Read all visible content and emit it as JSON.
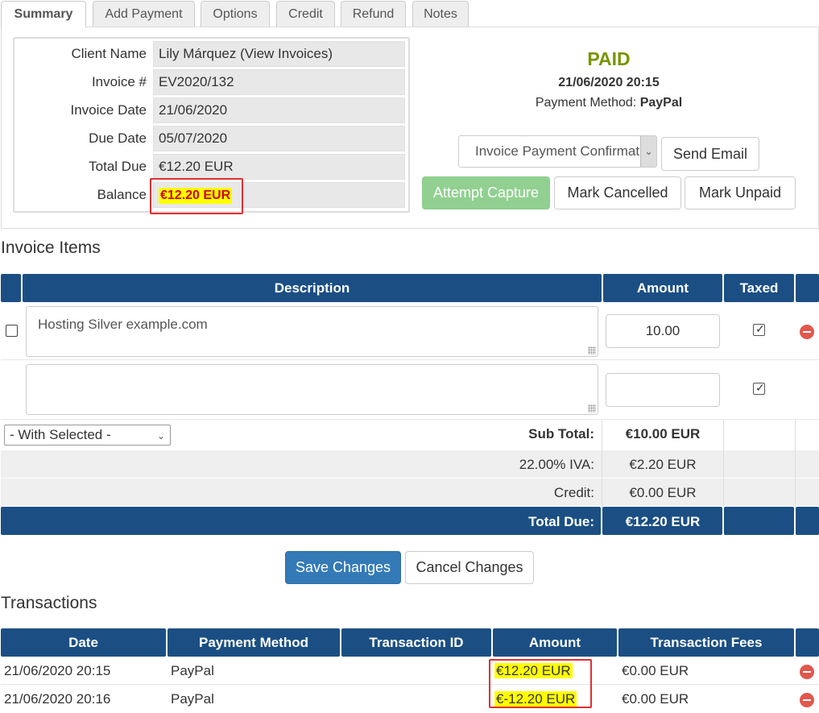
{
  "tabs": [
    "Summary",
    "Add Payment",
    "Options",
    "Credit",
    "Refund",
    "Notes"
  ],
  "summary": {
    "client_name_label": "Client Name",
    "client_name_value": "Lily Márquez (View Invoices)",
    "invoice_num_label": "Invoice #",
    "invoice_num_value": "EV2020/132",
    "invoice_date_label": "Invoice Date",
    "invoice_date_value": "21/06/2020",
    "due_date_label": "Due Date",
    "due_date_value": "05/07/2020",
    "total_due_label": "Total Due",
    "total_due_value": "€12.20 EUR",
    "balance_label": "Balance",
    "balance_value": "€12.20 EUR"
  },
  "status": {
    "state": "PAID",
    "datetime": "21/06/2020 20:15",
    "method_label": "Payment Method:",
    "method_value": "PayPal",
    "email_template": "Invoice Payment Confirmation",
    "send_email": "Send Email",
    "attempt_capture": "Attempt Capture",
    "mark_cancelled": "Mark Cancelled",
    "mark_unpaid": "Mark Unpaid",
    "colors": {
      "paid": "#779500",
      "header": "#1b4f84",
      "capture": "#91d091"
    }
  },
  "items": {
    "title": "Invoice Items",
    "headers": {
      "description": "Description",
      "amount": "Amount",
      "taxed": "Taxed"
    },
    "rows": [
      {
        "description": "Hosting Silver example.com",
        "amount": "10.00",
        "taxed": true
      },
      {
        "description": "",
        "amount": "",
        "taxed": true
      }
    ],
    "with_selected": "- With Selected -",
    "subtotal_label": "Sub Total:",
    "subtotal_value": "€10.00 EUR",
    "tax_label": "22.00% IVA:",
    "tax_value": "€2.20 EUR",
    "credit_label": "Credit:",
    "credit_value": "€0.00 EUR",
    "total_label": "Total Due:",
    "total_value": "€12.20 EUR"
  },
  "actions": {
    "save": "Save Changes",
    "cancel": "Cancel Changes"
  },
  "transactions": {
    "title": "Transactions",
    "headers": [
      "Date",
      "Payment Method",
      "Transaction ID",
      "Amount",
      "Transaction Fees"
    ],
    "rows": [
      {
        "date": "21/06/2020 20:15",
        "method": "PayPal",
        "id": "",
        "amount": "€12.20 EUR",
        "fees": "€0.00 EUR"
      },
      {
        "date": "21/06/2020 20:16",
        "method": "PayPal",
        "id": "",
        "amount": "€-12.20 EUR",
        "fees": "€0.00 EUR"
      }
    ]
  }
}
